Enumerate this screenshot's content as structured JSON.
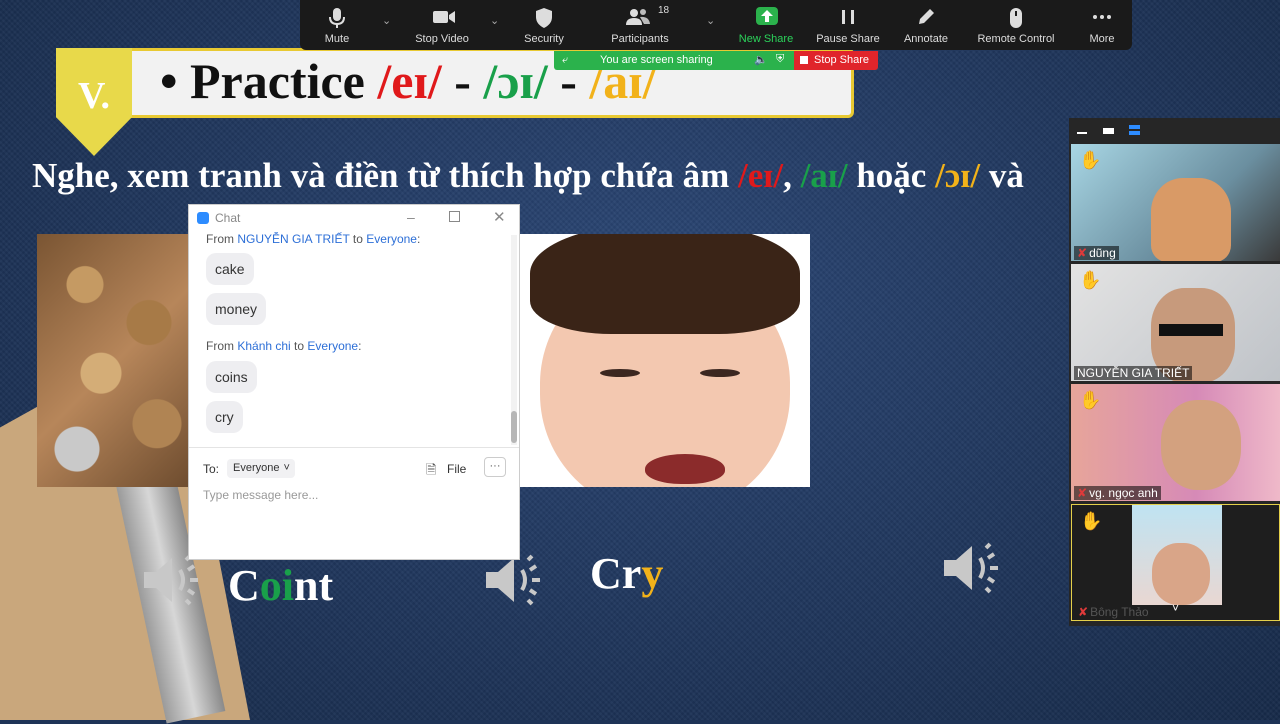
{
  "slide": {
    "badge": "V.",
    "title": {
      "prefix": "• Practice ",
      "ei": "/eɪ/",
      "sep1": " - ",
      "oi": "/ɔɪ/",
      "sep2": " - ",
      "ai": "/aɪ/"
    },
    "instruction": {
      "text1": "Nghe, xem tranh và điền từ thích hợp chứa âm ",
      "ei": "/eɪ/",
      "comma": ", ",
      "ai": "/aɪ/",
      "mid": " hoặc ",
      "oi": "/ɔɪ/",
      "tail": " và"
    },
    "words": [
      {
        "a": "C",
        "b": "oi",
        "c": "nt"
      },
      {
        "a": "Cr",
        "b": "y"
      }
    ]
  },
  "toolbar": {
    "buttons": [
      {
        "label": "Mute",
        "icon": "microphone-icon"
      },
      {
        "label": "Stop Video",
        "icon": "video-camera-icon"
      },
      {
        "label": "Security",
        "icon": "shield-icon"
      },
      {
        "label": "Participants",
        "icon": "participants-icon",
        "count": "18"
      },
      {
        "label": "New Share",
        "icon": "share-arrow-icon"
      },
      {
        "label": "Pause Share",
        "icon": "pause-icon"
      },
      {
        "label": "Annotate",
        "icon": "pencil-icon"
      },
      {
        "label": "Remote Control",
        "icon": "mouse-icon"
      },
      {
        "label": "More",
        "icon": "ellipsis-icon"
      }
    ],
    "sharing_status": "You are screen sharing",
    "stop_share": "Stop Share",
    "colors": {
      "new_share": "#2bb24c",
      "stop": "#e0252b"
    }
  },
  "chat": {
    "title": "Chat",
    "messages": [
      {
        "from_label": "From ",
        "sender": "NGUYỄN GIA TRIẾT",
        "to_label": " to ",
        "recipient": "Everyone",
        "suffix": ":",
        "lines": [
          "cake",
          "money"
        ]
      },
      {
        "from_label": "From ",
        "sender": "Khánh chi",
        "to_label": " to ",
        "recipient": "Everyone",
        "suffix": ":",
        "lines": [
          "coins",
          "cry"
        ]
      }
    ],
    "to_label": "To:",
    "recipient_select": "Everyone",
    "file_label": "File",
    "more": "···",
    "input_placeholder": "Type message here..."
  },
  "gallery": {
    "participants": [
      {
        "name": "dũng",
        "muted": true
      },
      {
        "name": "NGUYỄN GIA TRIẾT",
        "muted": false
      },
      {
        "name": "vg. ngọc anh",
        "muted": true
      },
      {
        "name": "Bông Thảo",
        "muted": true
      }
    ]
  }
}
